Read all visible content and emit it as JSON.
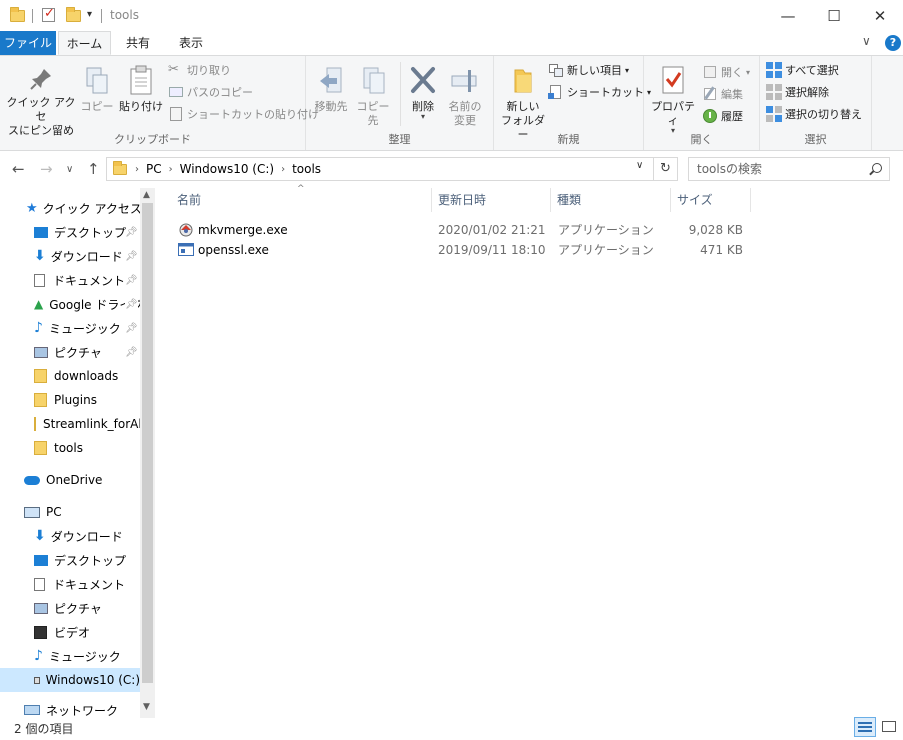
{
  "window": {
    "title": "tools",
    "minimize": "—",
    "maximize": "☐",
    "close": "✕"
  },
  "ribbon_tabs": {
    "file": "ファイル",
    "home": "ホーム",
    "share": "共有",
    "view": "表示",
    "collapse": "∨",
    "help": "?"
  },
  "ribbon": {
    "clipboard": {
      "label": "クリップボード",
      "pin_line1": "クイック アクセ",
      "pin_line2": "スにピン留め",
      "copy": "コピー",
      "paste": "貼り付け",
      "cut": "切り取り",
      "copy_path": "パスのコピー",
      "paste_shortcut": "ショートカットの貼り付け"
    },
    "organize": {
      "label": "整理",
      "move_to": "移動先",
      "copy_to": "コピー先",
      "delete": "削除",
      "rename_line1": "名前の",
      "rename_line2": "変更"
    },
    "new": {
      "label": "新規",
      "new_folder_line1": "新しい",
      "new_folder_line2": "フォルダー",
      "new_item": "新しい項目",
      "shortcut": "ショートカット"
    },
    "open": {
      "label": "開く",
      "properties": "プロパティ",
      "open": "開く",
      "edit": "編集",
      "history": "履歴"
    },
    "select": {
      "label": "選択",
      "select_all": "すべて選択",
      "select_none": "選択解除",
      "invert": "選択の切り替え"
    }
  },
  "address": {
    "parts": [
      "PC",
      "Windows10 (C:)",
      "tools"
    ],
    "search_placeholder": "toolsの検索"
  },
  "nav": {
    "quick_access": "クイック アクセス",
    "qa_items": [
      "デスクトップ",
      "ダウンロード",
      "ドキュメント",
      "Google ドライブ",
      "ミュージック",
      "ピクチャ",
      "downloads",
      "Plugins",
      "Streamlink_forAl",
      "tools"
    ],
    "onedrive": "OneDrive",
    "pc": "PC",
    "pc_items": [
      "ダウンロード",
      "デスクトップ",
      "ドキュメント",
      "ピクチャ",
      "ビデオ",
      "ミュージック",
      "Windows10 (C:)"
    ],
    "network": "ネットワーク"
  },
  "columns": {
    "name": "名前",
    "modified": "更新日時",
    "type": "種類",
    "size": "サイズ"
  },
  "files": [
    {
      "name": "mkvmerge.exe",
      "modified": "2020/01/02 21:21",
      "type": "アプリケーション",
      "size": "9,028 KB"
    },
    {
      "name": "openssl.exe",
      "modified": "2019/09/11 18:10",
      "type": "アプリケーション",
      "size": "471 KB"
    }
  ],
  "status": {
    "count": "2 個の項目"
  },
  "colors": {
    "accent": "#1979ca",
    "selection": "#cce8ff",
    "folder": "#f7d36a"
  }
}
